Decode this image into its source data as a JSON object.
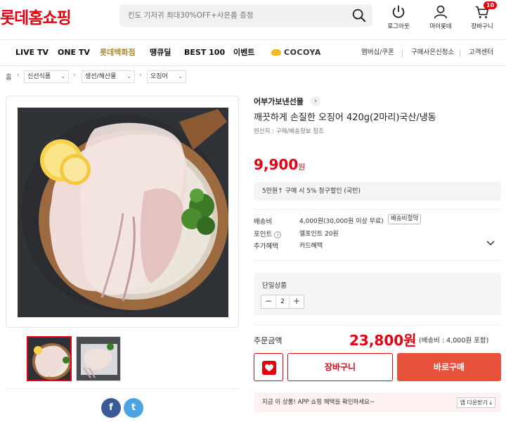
{
  "header": {
    "logo": "롯데홈쇼핑",
    "search_placeholder": "킨도 기저귀 최대30%OFF+사은품 증정",
    "logout_label": "로그아웃",
    "mylotte_label": "마이롯데",
    "cart_label": "장바구니",
    "cart_count": "10"
  },
  "nav": {
    "items": [
      "LIVE TV",
      "ONE TV",
      "롯데백화점",
      "땡큐딜",
      "BEST 100",
      "이벤트",
      "COCOYA"
    ],
    "right_items": [
      "멤버십/쿠폰",
      "구매사은신청소",
      "고객센터"
    ]
  },
  "breadcrumb": {
    "home": "홈",
    "levels": [
      "신선식품",
      "생선/해산물",
      "오징어"
    ]
  },
  "product": {
    "brand": "어부가보낸선물",
    "title": "깨끗하게 손질한 오징어 420g(2마리)국산/냉동",
    "origin": "원산지 : 구매/배송정보 참조",
    "price": "9,900",
    "price_unit": "원",
    "discount_note": "5만원↑ 구매 시 5% 청구할인 (국민)"
  },
  "details": {
    "shipping_label": "배송비",
    "shipping_value": "4,000원(30,000원 이상 무료)",
    "shipping_tag": "배송비절약",
    "point_label": "포인트",
    "point_value": "엘포인트 20원",
    "extra_label": "추가혜택",
    "extra_value": "카드혜택"
  },
  "option": {
    "name": "단일상품",
    "quantity": "2",
    "minus": "−",
    "plus": "+"
  },
  "order": {
    "total_label": "주문금액",
    "total_price": "23,800원",
    "shipping_note": "(배송비 : 4,000원 포함)",
    "cart_button": "장바구니",
    "buy_button": "바로구매"
  },
  "app_banner": {
    "text": "지금 이 상품! APP 쇼핑 혜택을 확인하세요~",
    "button": "앱 다운받기 ⤓"
  },
  "share": {
    "facebook": "f",
    "twitter": "t"
  },
  "colors": {
    "brand_red": "#e60012",
    "buy_button": "#e8523d",
    "dept_gold": "#b0892f"
  }
}
